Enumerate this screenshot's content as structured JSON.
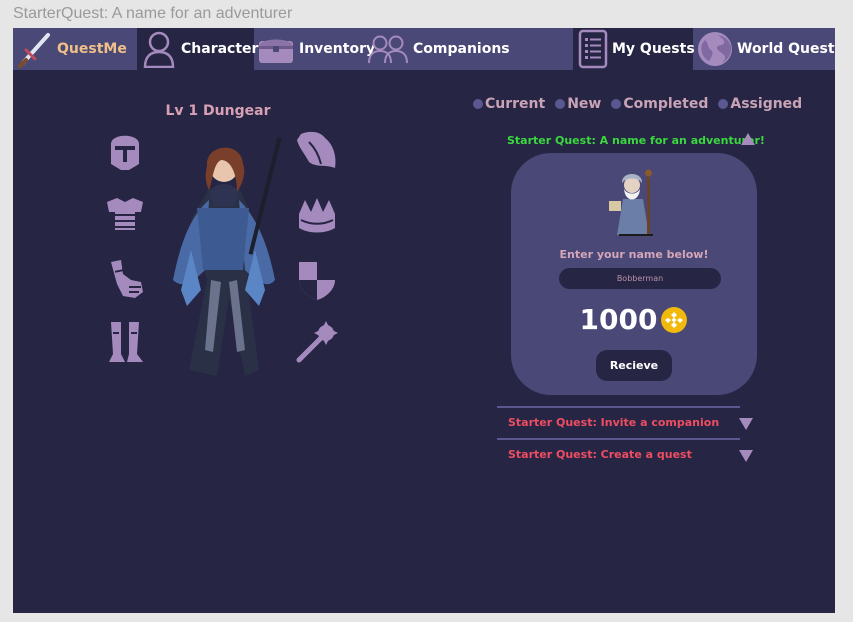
{
  "window_title": "StarterQuest: A name for an adventurer",
  "nav": {
    "brand": "QuestMe",
    "character": "Character",
    "inventory": "Inventory",
    "companions": "Companions",
    "my_quests": "My Quests",
    "world_quests": "World Quests"
  },
  "character": {
    "title": "Lv 1 Dungear",
    "equipment_slots": [
      "helmet-icon",
      "chest-armor-icon",
      "gauntlet-icon",
      "greaves-icon",
      "cape-icon",
      "crown-icon",
      "shield-icon",
      "mace-icon"
    ]
  },
  "quests": {
    "filters": [
      "Current",
      "New",
      "Completed",
      "Assigned"
    ],
    "active": {
      "title": "Starter Quest: A name for an adventurer!",
      "prompt": "Enter your name below!",
      "name_value": "Bobberman",
      "reward": "1000",
      "button": "Recieve"
    },
    "collapsed": [
      {
        "title": "Starter Quest: Invite a companion"
      },
      {
        "title": "Starter Quest: Create a quest"
      }
    ]
  },
  "colors": {
    "app_bg": "#262544",
    "nav_bg": "#4a4877",
    "card_bg": "#4a4877",
    "active_quest_title": "#3ad83e",
    "collapsed_quest_title": "#ef4d62",
    "icon": "#a58bbd",
    "coin": "#f0b90b"
  }
}
